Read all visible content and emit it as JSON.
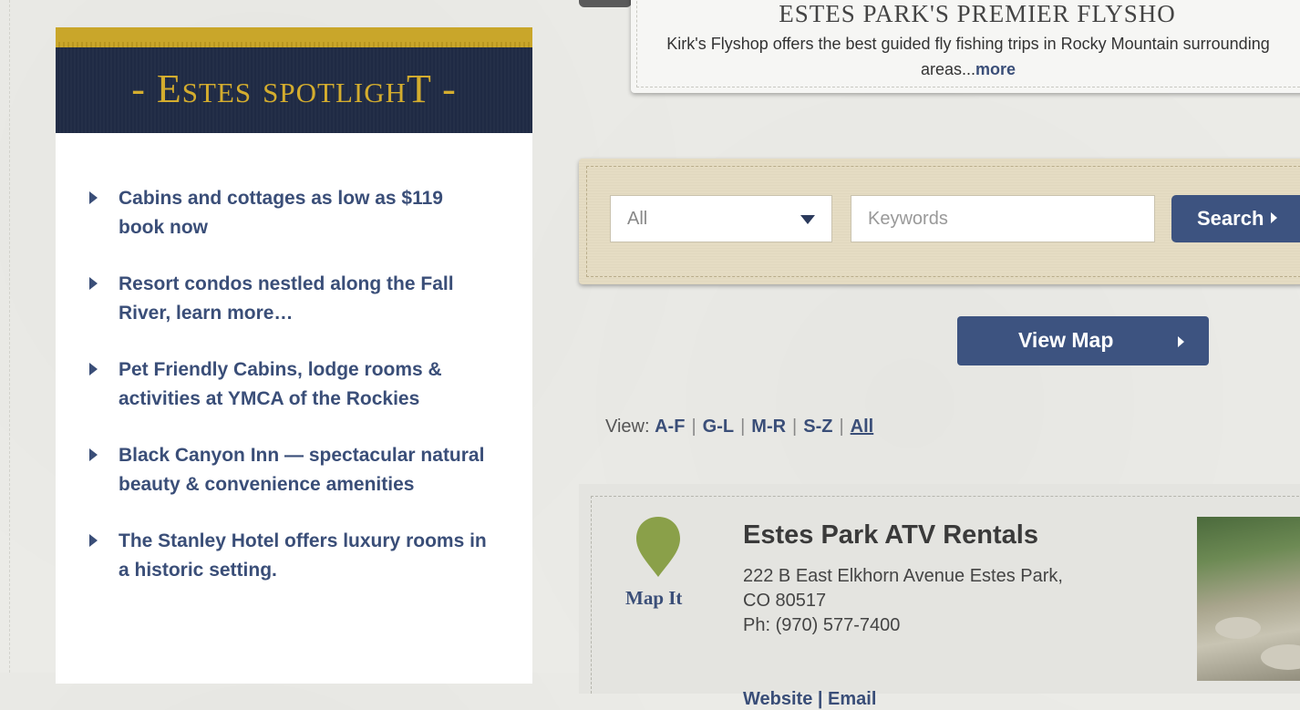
{
  "spotlight": {
    "title": "- Estes spotlighT -",
    "items": [
      {
        "label": "Cabins and cottages as low as $119 book now"
      },
      {
        "label": "Resort condos nestled along the Fall River, learn more…"
      },
      {
        "label": "Pet Friendly Cabins, lodge rooms & activities at YMCA of the Rockies"
      },
      {
        "label": "Black Canyon Inn — spectacular natural beauty & convenience amenities"
      },
      {
        "label": "The Stanley Hotel offers luxury rooms in a historic setting."
      }
    ]
  },
  "featured": {
    "heading": "ESTES PARK'S PREMIER FLYSHO",
    "text": "Kirk's Flyshop offers the best guided fly fishing trips in Rocky Mountain surrounding areas...",
    "more_label": "more"
  },
  "search": {
    "category_value": "All",
    "keyword_placeholder": "Keywords",
    "button_label": "Search"
  },
  "view_map": {
    "label": "View Map"
  },
  "view_filter": {
    "label": "View:",
    "options": [
      "A-F",
      "G-L",
      "M-R",
      "S-Z",
      "All"
    ]
  },
  "listing": {
    "map_it_label": "Map It",
    "name": "Estes Park ATV Rentals",
    "address_line1": "222 B East Elkhorn Avenue Estes Park,",
    "address_line2": "CO 80517",
    "phone": "Ph: (970) 577-7400",
    "links": "Website | Email"
  },
  "colors": {
    "navy": "#3d5380",
    "gold": "#c9a62a",
    "header_bg": "#1f2a44",
    "pin_green": "#8aa049"
  }
}
